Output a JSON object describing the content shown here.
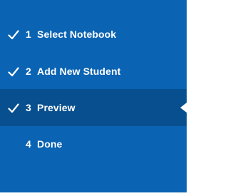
{
  "steps": [
    {
      "number": "1",
      "label": "Select Notebook",
      "icon": "checkmark-icon",
      "completed": true,
      "active": false
    },
    {
      "number": "2",
      "label": "Add New Student",
      "icon": "checkmark-icon",
      "completed": true,
      "active": false
    },
    {
      "number": "3",
      "label": "Preview",
      "icon": "checkmark-icon",
      "completed": true,
      "active": true
    },
    {
      "number": "4",
      "label": "Done",
      "icon": "",
      "completed": false,
      "active": false
    }
  ],
  "colors": {
    "panel_background": "#0a63b3",
    "active_background": "#084f8f",
    "text": "#ffffff"
  }
}
